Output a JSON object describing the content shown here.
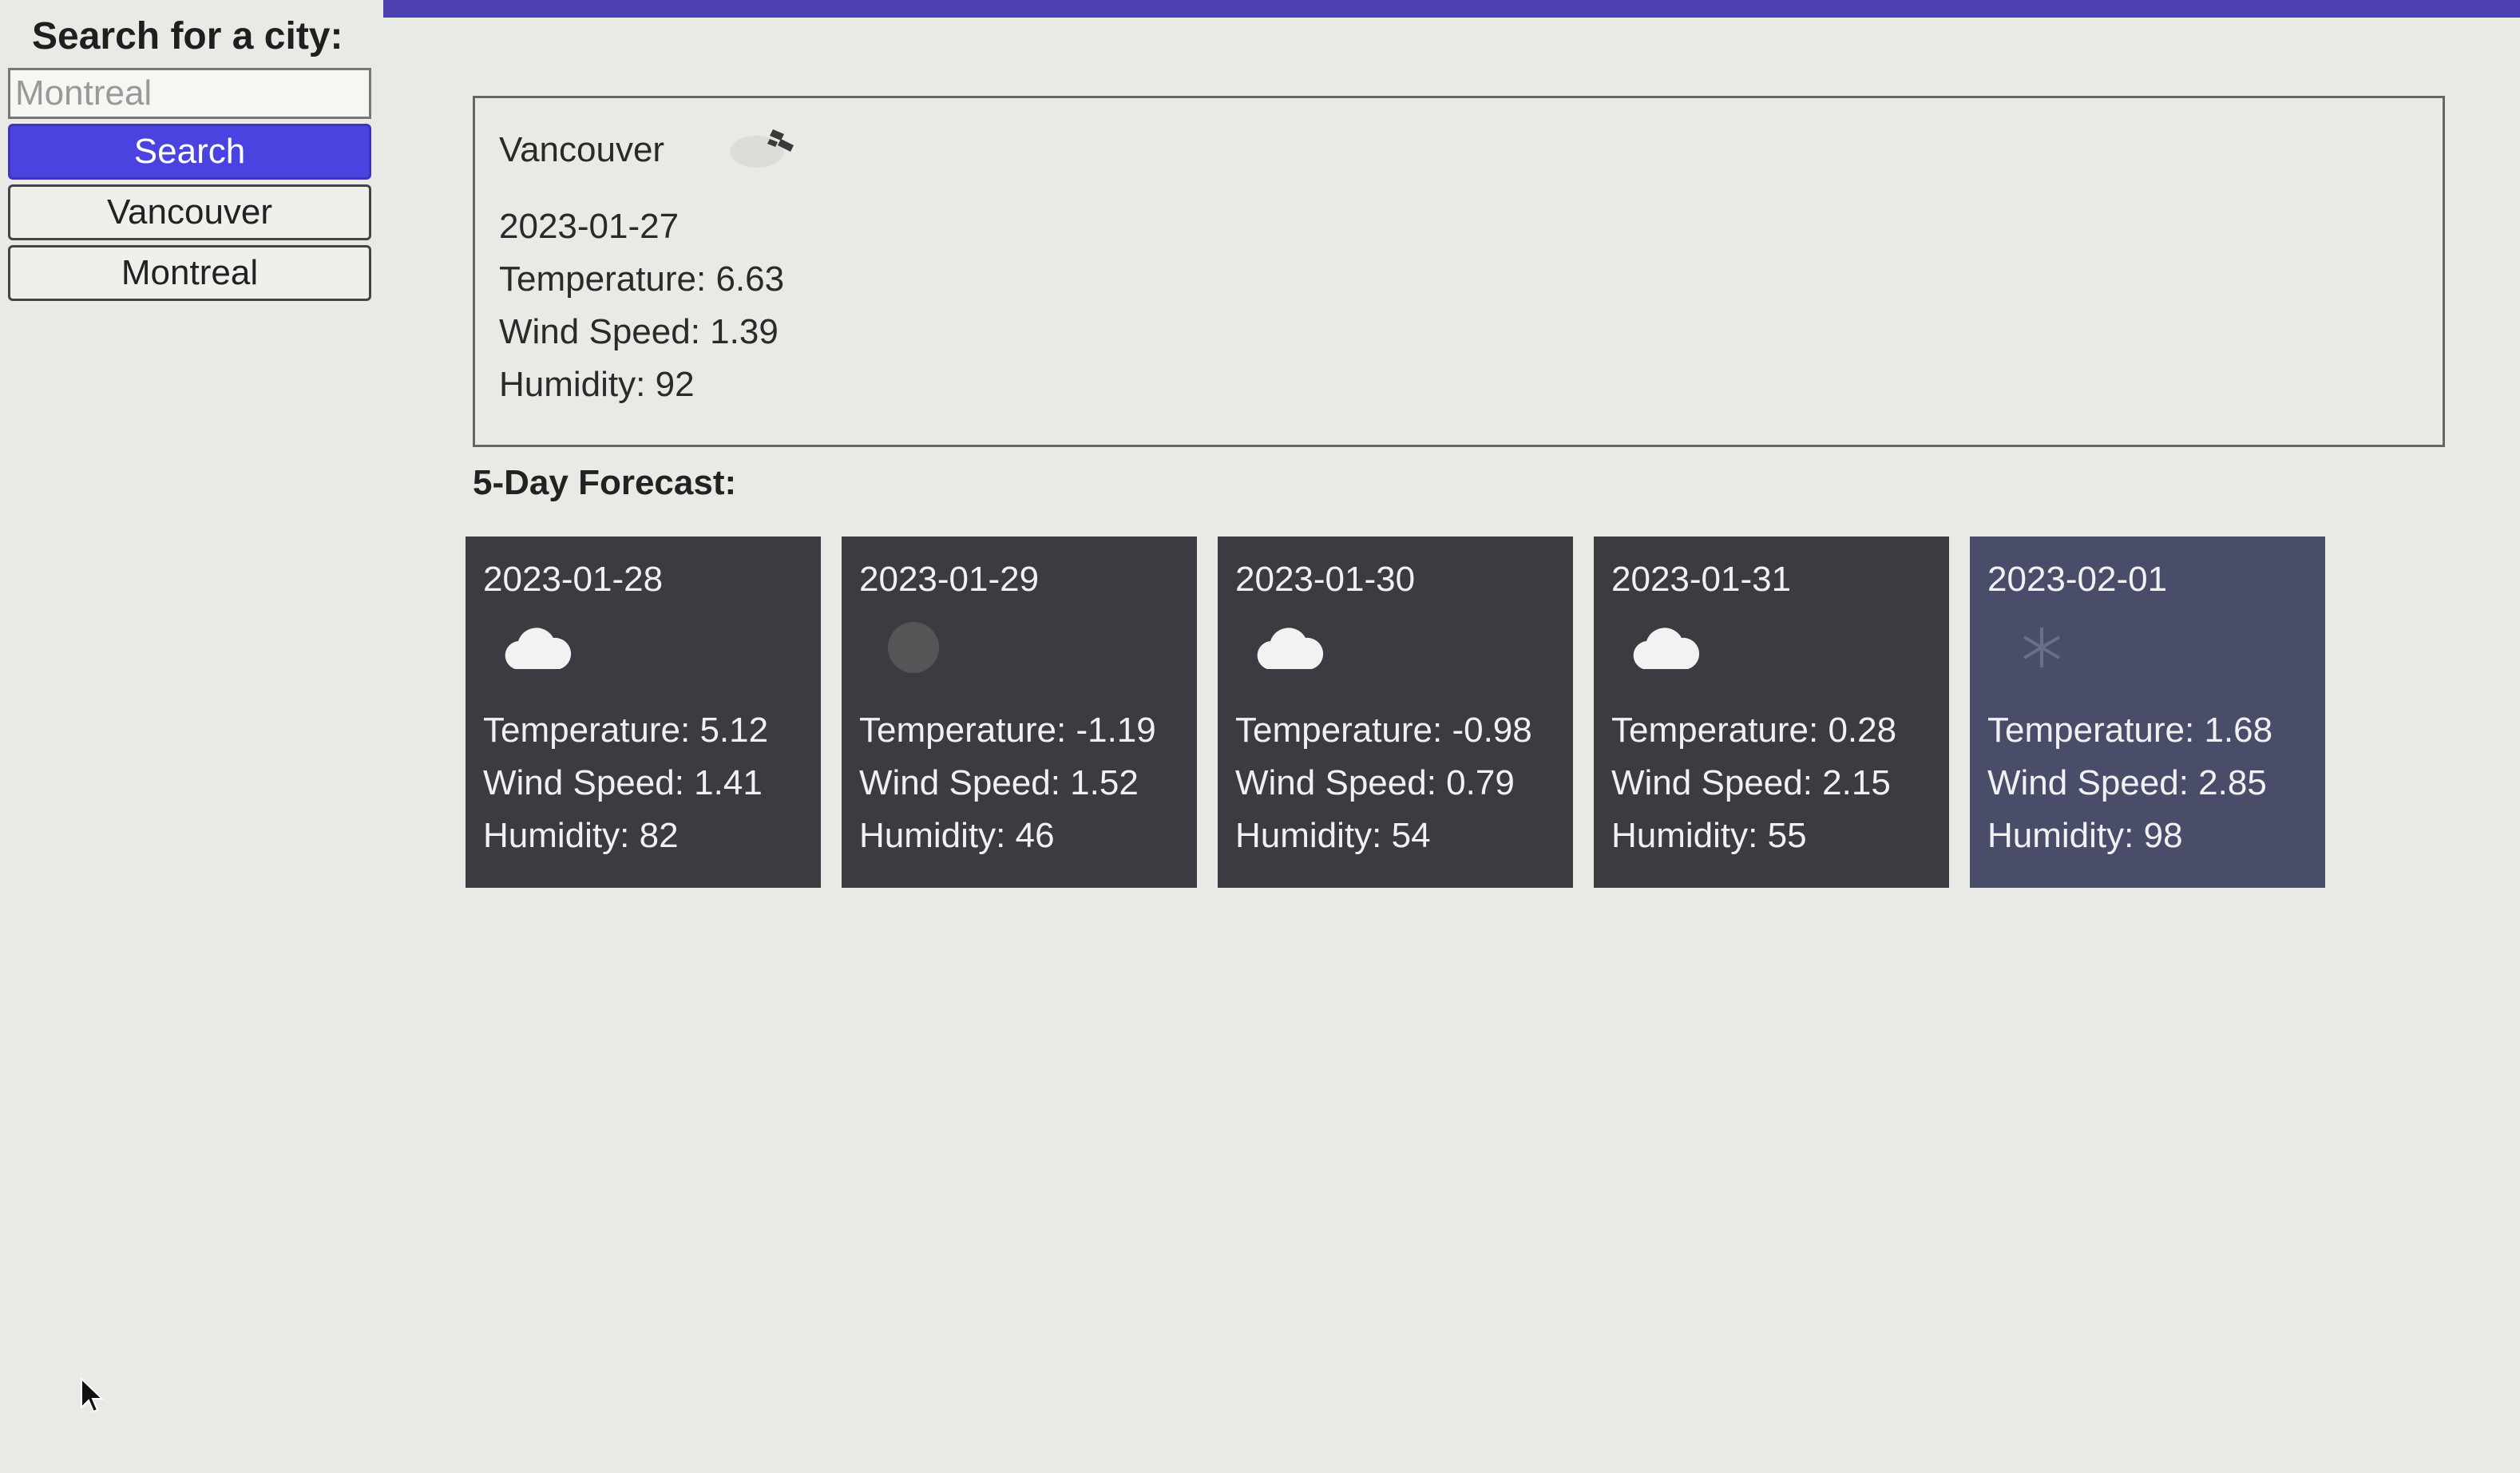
{
  "search": {
    "heading": "Search for a city:",
    "placeholder": "Montreal",
    "button_label": "Search",
    "history": [
      "Vancouver",
      "Montreal"
    ]
  },
  "current": {
    "city": "Vancouver",
    "icon": "few-clouds-icon",
    "date": "2023-01-27",
    "temperature": "Temperature: 6.63",
    "wind": "Wind Speed: 1.39",
    "humidity": "Humidity: 92"
  },
  "forecast": {
    "title": "5-Day Forecast:",
    "days": [
      {
        "date": "2023-01-28",
        "icon": "cloud-icon",
        "temperature": "Temperature: 5.12",
        "wind": "Wind Speed: 1.41",
        "humidity": "Humidity: 82"
      },
      {
        "date": "2023-01-29",
        "icon": "overcast-icon",
        "temperature": "Temperature: -1.19",
        "wind": "Wind Speed: 1.52",
        "humidity": "Humidity: 46"
      },
      {
        "date": "2023-01-30",
        "icon": "cloud-icon",
        "temperature": "Temperature: -0.98",
        "wind": "Wind Speed: 0.79",
        "humidity": "Humidity: 54"
      },
      {
        "date": "2023-01-31",
        "icon": "cloud-icon",
        "temperature": "Temperature: 0.28",
        "wind": "Wind Speed: 2.15",
        "humidity": "Humidity: 55"
      },
      {
        "date": "2023-02-01",
        "icon": "snow-icon",
        "temperature": "Temperature: 1.68",
        "wind": "Wind Speed: 2.85",
        "humidity": "Humidity: 98"
      }
    ]
  },
  "colors": {
    "accent": "#4b43e0",
    "card_bg": "#3b3b42",
    "page_bg": "#e9e9e5"
  }
}
